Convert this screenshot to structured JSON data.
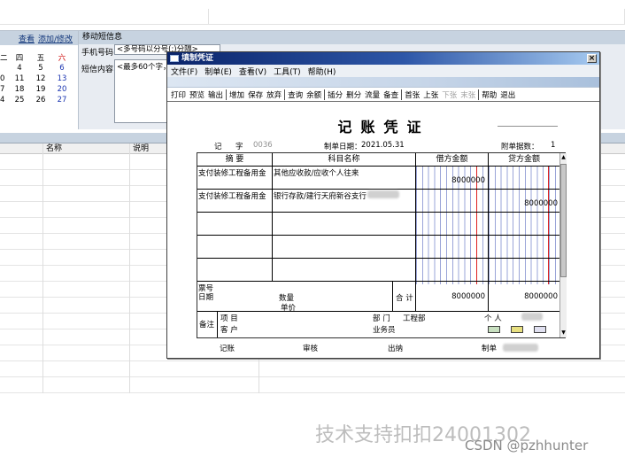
{
  "background_app": {
    "left_panel": {
      "view_link": "查看",
      "edit_link": "添加/修改"
    },
    "calendar": {
      "weekdays": [
        "二",
        "四",
        "五",
        "六"
      ],
      "rows": [
        [
          "",
          "4",
          "5",
          "6"
        ],
        [
          "0",
          "11",
          "12",
          "13"
        ],
        [
          "7",
          "18",
          "19",
          "20"
        ],
        [
          "4",
          "25",
          "26",
          "27"
        ]
      ]
    },
    "sms": {
      "title": "移动短信息",
      "phone_label": "手机号码",
      "phone_value": "<多号码以分号(;)分隔>",
      "content_label": "短信内容",
      "content_value": "<最多60个字，"
    },
    "grid": {
      "col_name": "名称",
      "col_desc": "说明"
    }
  },
  "dialog": {
    "title": "填制凭证",
    "close_label": "×",
    "menu": [
      "文件(F)",
      "制单(E)",
      "查看(V)",
      "工具(T)",
      "帮助(H)"
    ],
    "toolbar": [
      {
        "label": "打印"
      },
      {
        "label": "预览"
      },
      {
        "label": "输出"
      },
      {
        "sep": true
      },
      {
        "label": "增加"
      },
      {
        "label": "保存"
      },
      {
        "label": "放弃"
      },
      {
        "sep": true
      },
      {
        "label": "查询"
      },
      {
        "label": "余额"
      },
      {
        "sep": true
      },
      {
        "label": "插分"
      },
      {
        "label": "删分"
      },
      {
        "label": "流量"
      },
      {
        "label": "备查"
      },
      {
        "sep": true
      },
      {
        "label": "首张"
      },
      {
        "label": "上张"
      },
      {
        "label": "下张",
        "disabled": true
      },
      {
        "label": "末张",
        "disabled": true
      },
      {
        "sep": true
      },
      {
        "label": "帮助"
      },
      {
        "label": "退出"
      }
    ],
    "voucher": {
      "title": "记账凭证",
      "type_label": "记",
      "zi": "字",
      "number": "0036",
      "date_label": "制单日期：",
      "date": "2021.05.31",
      "attach_label": "附单据数：",
      "attach_count": "1",
      "headers": {
        "summary": "摘 要",
        "account": "科目名称",
        "debit": "借方金额",
        "credit": "贷方金额"
      },
      "entries": [
        {
          "summary": "支付装修工程备用金",
          "account": "其他应收款/应收个人往来",
          "debit": "8000000",
          "credit": ""
        },
        {
          "summary": "支付装修工程备用金",
          "account": "银行存款/建行天府新谷支行",
          "debit": "",
          "credit": "8000000"
        }
      ],
      "ticket_label": "票号",
      "date_row_label": "日期",
      "qty_label": "数量",
      "price_label": "单价",
      "total_label": "合 计",
      "total_debit": "8000000",
      "total_credit": "8000000",
      "remark_label": "备注",
      "project_label": "项 目",
      "customer_label": "客 户",
      "dept_label": "部 门",
      "dept_value": "工程部",
      "person_label": "个 人",
      "salesman_label": "业务员",
      "footer": {
        "bookkeeper": "记账",
        "reviewer": "审核",
        "cashier": "出纳",
        "maker": "制单"
      }
    }
  },
  "watermarks": {
    "support": "技术支持扣扣24001302",
    "csdn": "CSDN @pzhhunter"
  },
  "colors": {
    "titlebar": "#0a246a",
    "panel": "#c7d3e0",
    "accent_red": "#e02020",
    "amount_grid": "#9aa4d8"
  }
}
